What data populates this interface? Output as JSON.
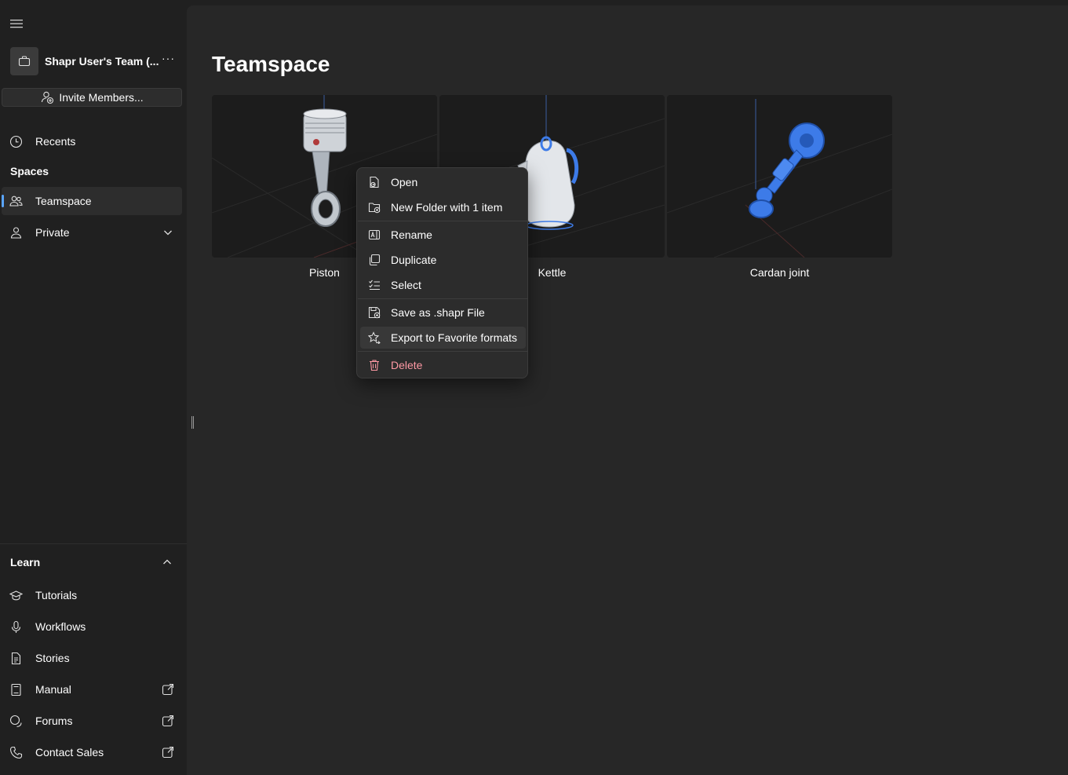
{
  "sidebar": {
    "team_name": "Shapr User's Team (...",
    "more_label": "···",
    "invite_label": "Invite Members...",
    "recents_label": "Recents",
    "spaces_title": "Spaces",
    "teamspace_label": "Teamspace",
    "private_label": "Private",
    "learn_title": "Learn",
    "learn_items": [
      {
        "label": "Tutorials",
        "icon": "graduation-cap-icon"
      },
      {
        "label": "Workflows",
        "icon": "microphone-icon"
      },
      {
        "label": "Stories",
        "icon": "document-icon"
      },
      {
        "label": "Manual",
        "icon": "notebook-icon",
        "external": true
      },
      {
        "label": "Forums",
        "icon": "chat-icon",
        "external": true
      },
      {
        "label": "Contact Sales",
        "icon": "phone-icon",
        "external": true
      }
    ]
  },
  "main": {
    "title": "Teamspace",
    "cards": [
      {
        "label": "Piston"
      },
      {
        "label": "Kettle"
      },
      {
        "label": "Cardan joint"
      }
    ]
  },
  "context_menu": {
    "items": [
      {
        "label": "Open",
        "icon": "open-icon"
      },
      {
        "label": "New Folder with 1 item",
        "icon": "new-folder-icon"
      },
      {
        "label": "Rename",
        "icon": "rename-icon"
      },
      {
        "label": "Duplicate",
        "icon": "duplicate-icon"
      },
      {
        "label": "Select",
        "icon": "select-list-icon"
      },
      {
        "label": "Save as .shapr File",
        "icon": "save-icon"
      },
      {
        "label": "Export to Favorite formats",
        "icon": "star-export-icon",
        "hovered": true
      },
      {
        "label": "Delete",
        "icon": "trash-icon",
        "danger": true
      }
    ]
  },
  "colors": {
    "accent": "#5aa5ff",
    "danger": "#ff99a4",
    "model_blue": "#3d7be8"
  }
}
